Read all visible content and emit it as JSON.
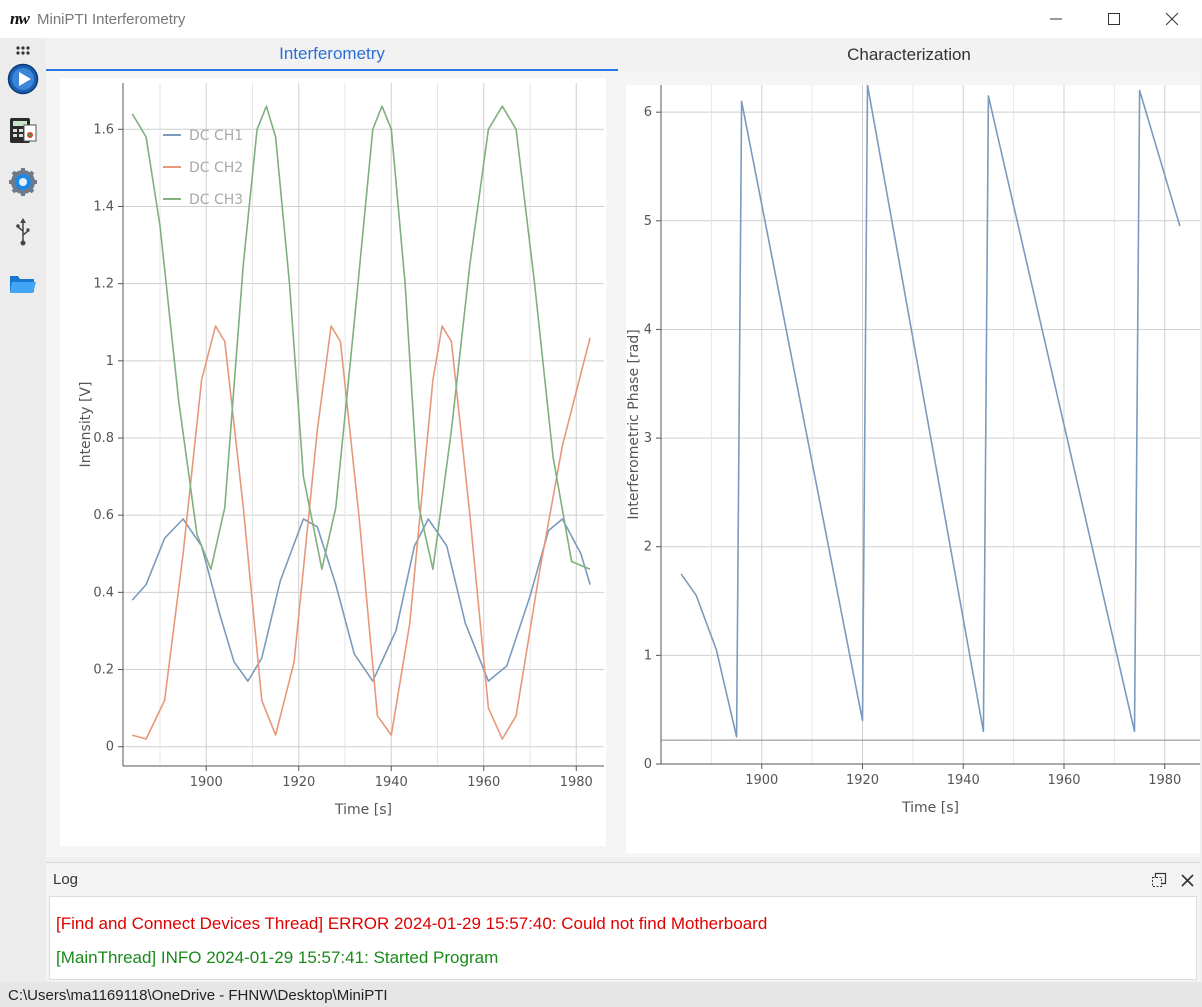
{
  "window": {
    "logo": "nw",
    "title": "MiniPTI Interferometry"
  },
  "toolbar": {
    "items": [
      {
        "icon": "grip-dots-icon"
      },
      {
        "icon": "play-icon"
      },
      {
        "icon": "calculator-icon"
      },
      {
        "icon": "settings-gear-icon"
      },
      {
        "icon": "usb-icon"
      },
      {
        "icon": "folder-icon"
      }
    ]
  },
  "tabs": [
    {
      "label": "Interferometry",
      "active": true
    },
    {
      "label": "Characterization",
      "active": false
    }
  ],
  "chart_data": [
    {
      "type": "line",
      "title": "",
      "xlabel": "Time [s]",
      "ylabel": "Intensity [V]",
      "xlim": [
        1882,
        1986
      ],
      "ylim": [
        -0.05,
        1.72
      ],
      "xticks": [
        "1900",
        "1920",
        "1940",
        "1960",
        "1980"
      ],
      "yticks": [
        "0",
        "0.2",
        "0.4",
        "0.6",
        "0.8",
        "1",
        "1.2",
        "1.4",
        "1.6"
      ],
      "grid": true,
      "legend_position": "top-left",
      "series": [
        {
          "name": "DC CH1",
          "color": "#7a9bbd",
          "x": [
            1884,
            1887,
            1891,
            1895,
            1899,
            1903,
            1906,
            1909,
            1912,
            1916,
            1921,
            1924,
            1928,
            1932,
            1936,
            1941,
            1945,
            1948,
            1952,
            1956,
            1961,
            1965,
            1970,
            1974,
            1977,
            1981,
            1983
          ],
          "y": [
            0.38,
            0.42,
            0.54,
            0.59,
            0.52,
            0.34,
            0.22,
            0.17,
            0.23,
            0.43,
            0.59,
            0.57,
            0.42,
            0.24,
            0.17,
            0.3,
            0.52,
            0.59,
            0.52,
            0.32,
            0.17,
            0.21,
            0.39,
            0.56,
            0.59,
            0.5,
            0.42
          ]
        },
        {
          "name": "DC CH2",
          "color": "#e8987a",
          "x": [
            1884,
            1887,
            1891,
            1895,
            1899,
            1902,
            1904,
            1908,
            1912,
            1915,
            1919,
            1924,
            1927,
            1929,
            1933,
            1937,
            1940,
            1944,
            1949,
            1951,
            1953,
            1957,
            1961,
            1964,
            1967,
            1972,
            1977,
            1983
          ],
          "y": [
            0.03,
            0.02,
            0.12,
            0.5,
            0.95,
            1.09,
            1.05,
            0.62,
            0.12,
            0.03,
            0.22,
            0.82,
            1.09,
            1.05,
            0.6,
            0.08,
            0.03,
            0.32,
            0.95,
            1.09,
            1.05,
            0.6,
            0.1,
            0.02,
            0.08,
            0.45,
            0.78,
            1.06
          ]
        },
        {
          "name": "DC CH3",
          "color": "#7fb07d",
          "x": [
            1884,
            1887,
            1890,
            1894,
            1898,
            1901,
            1904,
            1908,
            1911,
            1913,
            1915,
            1918,
            1921,
            1925,
            1928,
            1932,
            1936,
            1938,
            1940,
            1943,
            1946,
            1949,
            1953,
            1957,
            1961,
            1964,
            1967,
            1971,
            1975,
            1979,
            1983
          ],
          "y": [
            1.64,
            1.58,
            1.35,
            0.9,
            0.55,
            0.46,
            0.62,
            1.25,
            1.6,
            1.66,
            1.58,
            1.2,
            0.7,
            0.46,
            0.62,
            1.1,
            1.6,
            1.66,
            1.6,
            1.2,
            0.62,
            0.46,
            0.82,
            1.25,
            1.6,
            1.66,
            1.6,
            1.2,
            0.75,
            0.48,
            0.46
          ]
        }
      ]
    },
    {
      "type": "line",
      "title": "",
      "xlabel": "Time [s]",
      "ylabel": "Interferometric Phase [rad]",
      "xlim": [
        1880,
        1987
      ],
      "ylim": [
        0,
        6.25
      ],
      "xticks": [
        "1900",
        "1920",
        "1940",
        "1960",
        "1980"
      ],
      "yticks": [
        "0",
        "1",
        "2",
        "3",
        "4",
        "5",
        "6"
      ],
      "grid": true,
      "series": [
        {
          "name": "",
          "color": "#7a9bbd",
          "x": [
            1884,
            1887,
            1891,
            1895,
            1896,
            1920,
            1921,
            1944,
            1945,
            1974,
            1975,
            1983
          ],
          "y": [
            1.75,
            1.55,
            1.05,
            0.25,
            6.1,
            0.4,
            6.25,
            0.3,
            6.15,
            0.3,
            6.2,
            4.95
          ]
        }
      ]
    }
  ],
  "log": {
    "title": "Log",
    "lines": [
      {
        "text": "[Find and Connect Devices Thread] ERROR 2024-01-29 15:57:40: Could not find Motherboard",
        "color": "#e00000"
      },
      {
        "text": "[MainThread] INFO 2024-01-29 15:57:41: Started Program",
        "color": "#1a8a1a"
      }
    ]
  },
  "status": {
    "path": "C:\\Users\\ma1169118\\OneDrive - FHNW\\Desktop\\MiniPTI"
  }
}
